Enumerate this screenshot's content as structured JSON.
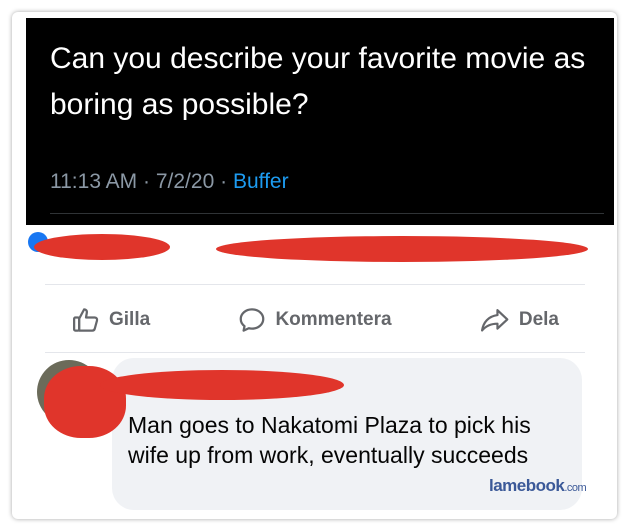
{
  "tweet": {
    "text": "Can you describe your favorite movie as boring as possible?",
    "time": "11:13 AM",
    "date": "7/2/20",
    "source": "Buffer",
    "separator": "·"
  },
  "actions": [
    {
      "label": "Gilla",
      "icon": "thumbs-up-icon"
    },
    {
      "label": "Kommentera",
      "icon": "comment-icon"
    },
    {
      "label": "Dela",
      "icon": "share-icon"
    }
  ],
  "comment": {
    "text": "Man goes to Nakatomi Plaza to pick his wife up from work, eventually succeeds"
  },
  "watermark": {
    "name": "lamebook",
    "domain": ".com"
  },
  "colors": {
    "redaction": "#e0352b",
    "action_text": "#65676b",
    "bubble": "#f0f2f5",
    "tweet_bg": "#000000",
    "tweet_source": "#1d9bf0"
  }
}
